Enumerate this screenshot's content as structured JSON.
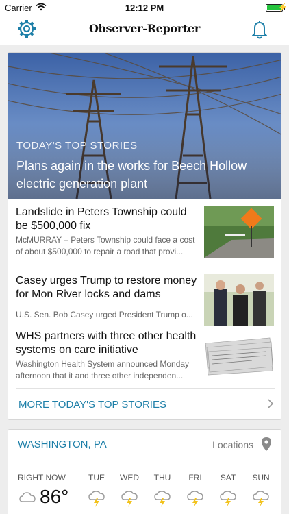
{
  "status_bar": {
    "carrier": "Carrier",
    "time": "12:12 PM"
  },
  "nav": {
    "masthead": "Observer-Reporter",
    "settings_icon": "gear-icon",
    "alerts_icon": "bell-icon",
    "accent": "#1d7fa8"
  },
  "hero": {
    "section_label": "TODAY'S TOP STORIES",
    "headline": "Plans again in the works for Beech Hollow electric generation plant"
  },
  "stories": [
    {
      "title": "Landslide in Peters Township could be $500,000 fix",
      "summary": "McMURRAY – Peters Township could face a cost of about $500,000 to repair a road that provi..."
    },
    {
      "title": "Casey urges Trump to restore money for Mon River locks and dams",
      "summary": "U.S. Sen. Bob Casey urged President Trump o..."
    },
    {
      "title": "WHS partners with three other health systems on care initiative",
      "summary": "Washington Health System announced Monday afternoon that it and three other independen..."
    }
  ],
  "more_link": {
    "label": "MORE TODAY'S TOP STORIES"
  },
  "weather": {
    "city": "WASHINGTON, PA",
    "locations_label": "Locations",
    "right_now_label": "RIGHT NOW",
    "current_temp": "86°",
    "current_icon": "cloud-icon",
    "forecast": [
      {
        "day": "TUE",
        "icon": "thunderstorm-icon"
      },
      {
        "day": "WED",
        "icon": "thunderstorm-icon"
      },
      {
        "day": "THU",
        "icon": "thunderstorm-icon"
      },
      {
        "day": "FRI",
        "icon": "thunderstorm-icon"
      },
      {
        "day": "SAT",
        "icon": "thunderstorm-icon"
      },
      {
        "day": "SUN",
        "icon": "thunderstorm-icon"
      }
    ]
  }
}
